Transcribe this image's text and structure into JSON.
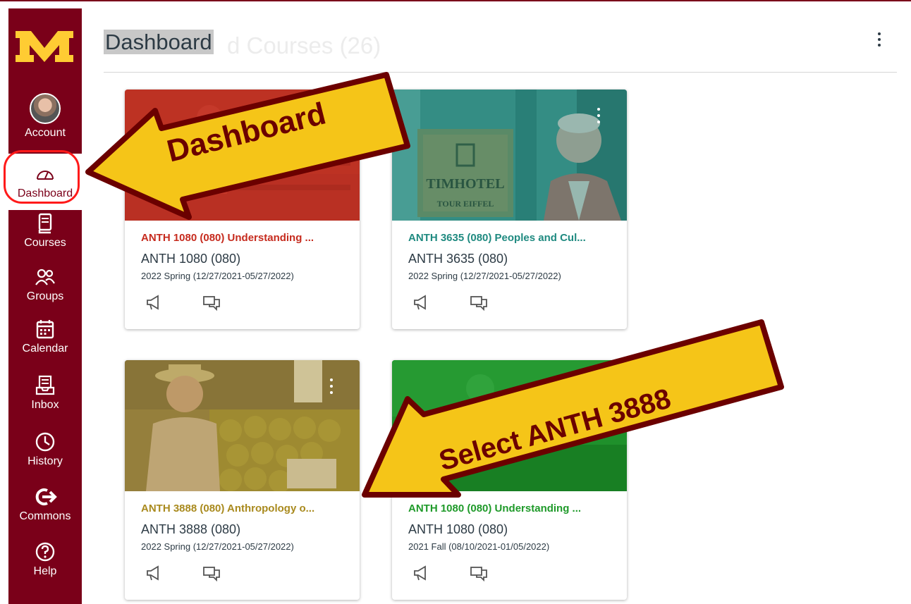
{
  "app": {
    "logo_text": "M",
    "page_title": "Dashboard",
    "ghost_title": "d Courses (26)"
  },
  "nav": {
    "items": [
      {
        "label": "Account",
        "icon": "avatar"
      },
      {
        "label": "Dashboard",
        "icon": "dashboard-gauge-icon"
      },
      {
        "label": "Courses",
        "icon": "book-icon"
      },
      {
        "label": "Groups",
        "icon": "people-icon"
      },
      {
        "label": "Calendar",
        "icon": "calendar-icon"
      },
      {
        "label": "Inbox",
        "icon": "inbox-icon"
      },
      {
        "label": "History",
        "icon": "clock-icon"
      },
      {
        "label": "Commons",
        "icon": "arrow-right-icon"
      },
      {
        "label": "Help",
        "icon": "question-icon"
      }
    ]
  },
  "courses": [
    {
      "title": "ANTH 1080 (080) Understanding ...",
      "code": "ANTH 1080 (080)",
      "term": "2022 Spring (12/27/2021-05/27/2022)",
      "color": "#c62b1e"
    },
    {
      "title": "ANTH 3635 (080) Peoples and Cul...",
      "code": "ANTH 3635 (080)",
      "term": "2022 Spring (12/27/2021-05/27/2022)",
      "color": "#1f8a80"
    },
    {
      "title": "ANTH 3888 (080) Anthropology o...",
      "code": "ANTH 3888 (080)",
      "term": "2022 Spring (12/27/2021-05/27/2022)",
      "color": "#a98a1e"
    },
    {
      "title": "ANTH 1080 (080) Understanding ...",
      "code": "ANTH 1080 (080)",
      "term": "2021 Fall (08/10/2021-01/05/2022)",
      "color": "#1f9a2a"
    }
  ],
  "hero_text": {
    "hotel_sign_line1": "TIMHOTEL",
    "hotel_sign_line2": "TOUR EIFFEL"
  },
  "annotations": {
    "arrow1": "Dashboard",
    "arrow2": "Select ANTH 3888"
  },
  "colors": {
    "brand": "#7a0019",
    "gold": "#ffcc33",
    "arrow_fill": "#f5c518",
    "arrow_stroke": "#6b0000",
    "highlight_ring": "#ff1a1a"
  }
}
